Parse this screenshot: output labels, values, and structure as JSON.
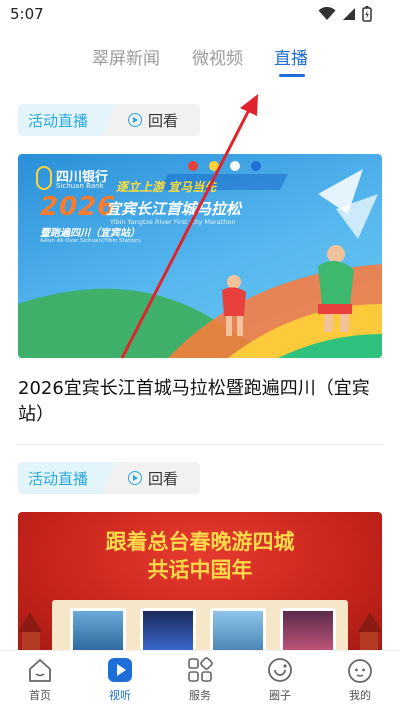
{
  "status_bar": {
    "time": "5:07"
  },
  "top_tabs": [
    {
      "label": "翠屏新闻"
    },
    {
      "label": "微视频"
    },
    {
      "label": "直播",
      "active": true
    }
  ],
  "cards": [
    {
      "badge_live": "活动直播",
      "badge_replay": "回看",
      "thumbnail": {
        "bank_cn": "四川银行",
        "bank_en": "Sichuan Bank",
        "slogan": "逐立上游  宜马当先",
        "year": "2026",
        "event_title": "宜宾长江首城马拉松",
        "event_en": "Yibin Yangtze River First City Marathon",
        "event_sub": "暨跑遍四川（宜宾站）",
        "event_sub_en": "&Run All Over Sichuan(Yibin Station)"
      },
      "title": "2026宜宾长江首城马拉松暨跑遍四川（宜宾站）"
    },
    {
      "badge_live": "活动直播",
      "badge_replay": "回看",
      "thumbnail": {
        "line1": "跟着总台春晚游四城",
        "line2": "共话中国年"
      }
    }
  ],
  "bottom_nav": [
    {
      "label": "首页",
      "icon": "home-icon"
    },
    {
      "label": "视听",
      "icon": "video-play-icon",
      "active": true
    },
    {
      "label": "服务",
      "icon": "services-grid-icon"
    },
    {
      "label": "圈子",
      "icon": "circle-icon"
    },
    {
      "label": "我的",
      "icon": "profile-face-icon"
    }
  ],
  "colors": {
    "accent": "#1e6ed8",
    "live_badge": "#2aa8dc",
    "live_badge_bg": "#e4f4fb",
    "annotation_arrow": "#e0242b"
  }
}
